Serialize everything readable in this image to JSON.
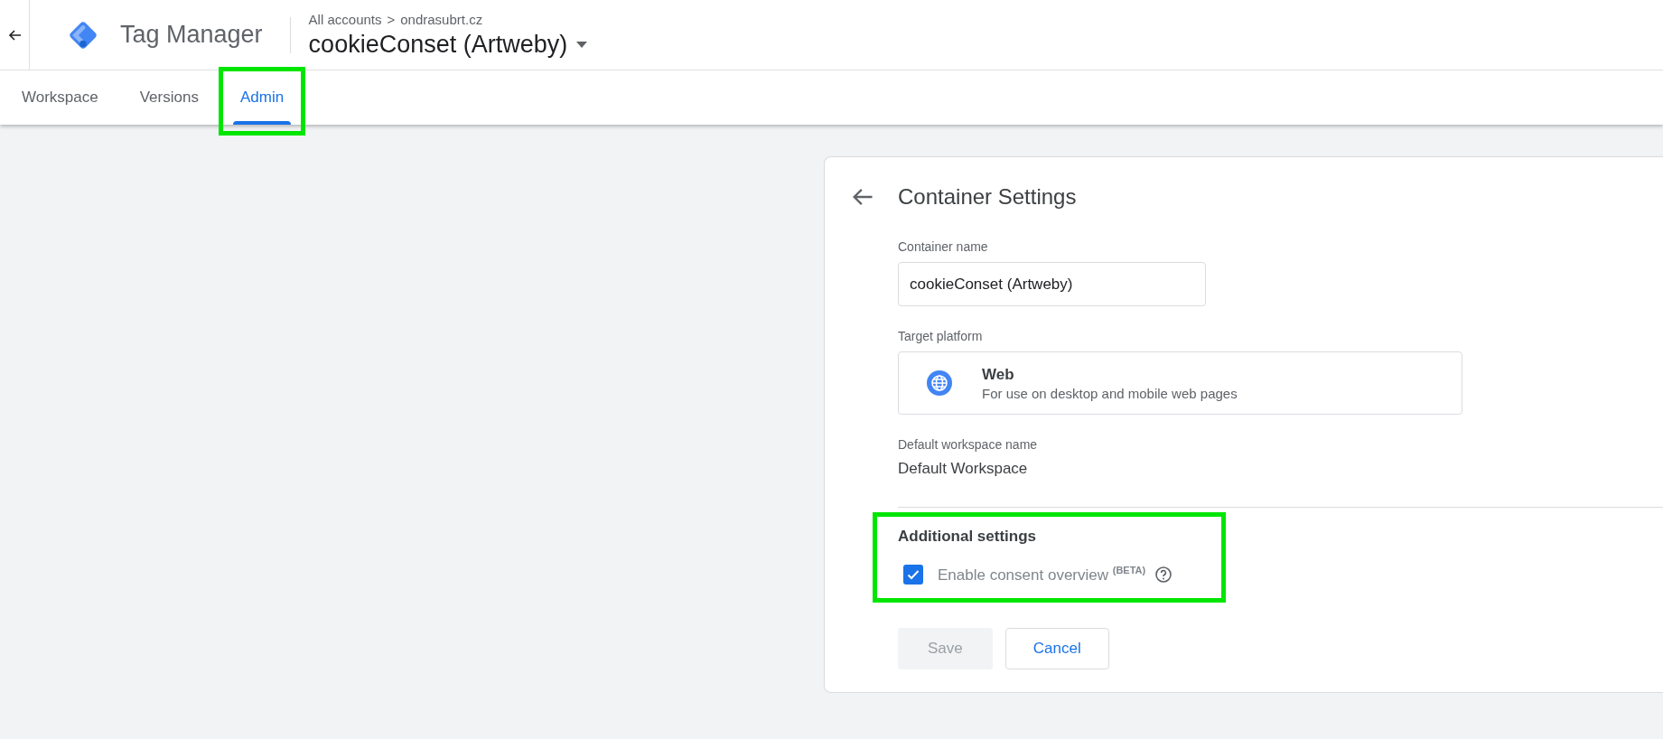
{
  "header": {
    "product": "Tag Manager",
    "breadcrumb": {
      "account": "All accounts",
      "separator": ">",
      "container": "ondrasubrt.cz"
    },
    "container_title": "cookieConset (Artweby)"
  },
  "tabs": [
    {
      "label": "Workspace",
      "selected": false,
      "highlighted": false
    },
    {
      "label": "Versions",
      "selected": false,
      "highlighted": false
    },
    {
      "label": "Admin",
      "selected": true,
      "highlighted": true
    }
  ],
  "card": {
    "title": "Container Settings",
    "container_name": {
      "label": "Container name",
      "value": "cookieConset (Artweby)"
    },
    "target_platform": {
      "label": "Target platform",
      "name": "Web",
      "description": "For use on desktop and mobile web pages"
    },
    "default_workspace": {
      "label": "Default workspace name",
      "value": "Default Workspace"
    },
    "additional_settings": {
      "title": "Additional settings",
      "highlighted": true,
      "option": {
        "label": "Enable consent overview",
        "badge": "(BETA)",
        "checked": true
      }
    },
    "buttons": [
      {
        "label": "Save",
        "disabled": true
      },
      {
        "label": "Cancel",
        "disabled": false
      }
    ]
  }
}
